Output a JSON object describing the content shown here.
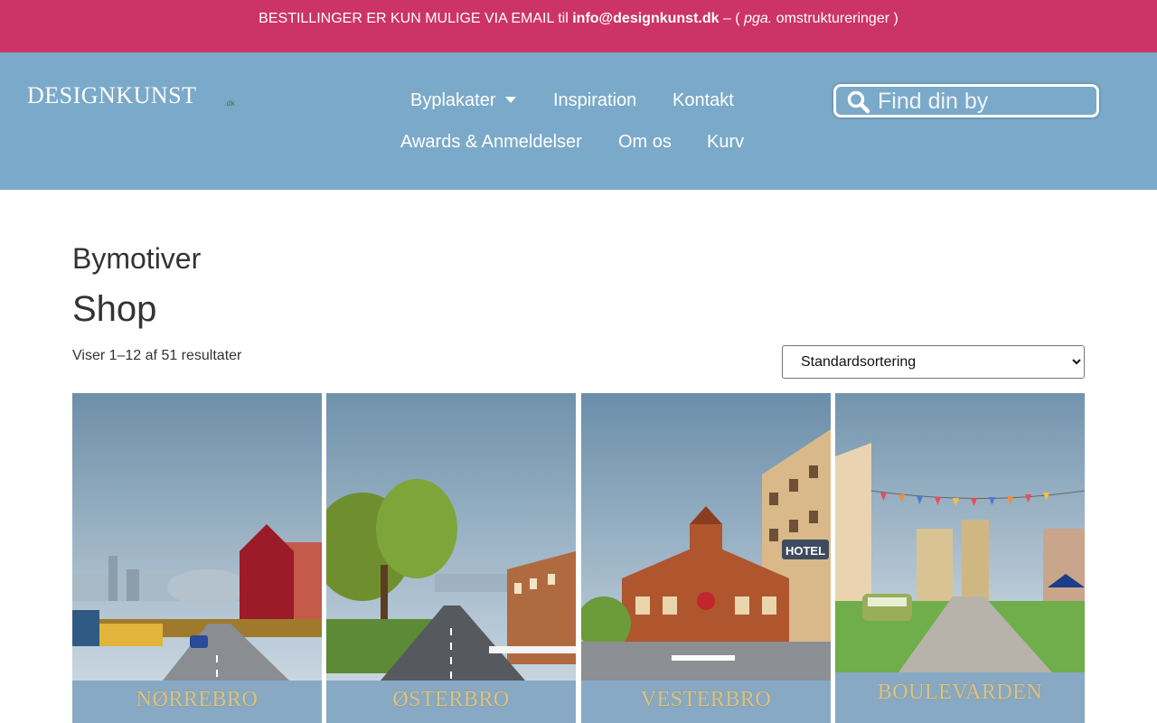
{
  "announcement": {
    "prefix": "BESTILLINGER ER KUN MULIGE VIA EMAIL til ",
    "email": "info@designkunst.dk",
    "mid": " – ( ",
    "italic": "pga.",
    "suffix": " omstruktureringer )"
  },
  "logo": {
    "text": "DESIGNKUNST",
    "suffix": ".dk"
  },
  "nav": {
    "byplakater": "Byplakater",
    "inspiration": "Inspiration",
    "kontakt": "Kontakt",
    "awards": "Awards & Anmeldelser",
    "om_os": "Om os",
    "kurv": "Kurv"
  },
  "search": {
    "placeholder": "Find din by"
  },
  "breadcrumb": "Bymotiver",
  "page_title": "Shop",
  "result_count": "Viser 1–12 af 51 resultater",
  "sort": {
    "selected": "Standardsortering"
  },
  "products": [
    {
      "label": "NØRREBRO"
    },
    {
      "label": "ØSTERBRO"
    },
    {
      "label": "VESTERBRO"
    },
    {
      "label": "BOULEVARDEN"
    }
  ],
  "colors": {
    "topbar": "#cc3366",
    "header": "#7ba9c9",
    "poster_footer": "#88a9c4"
  },
  "hotel_sign": "HOTEL"
}
